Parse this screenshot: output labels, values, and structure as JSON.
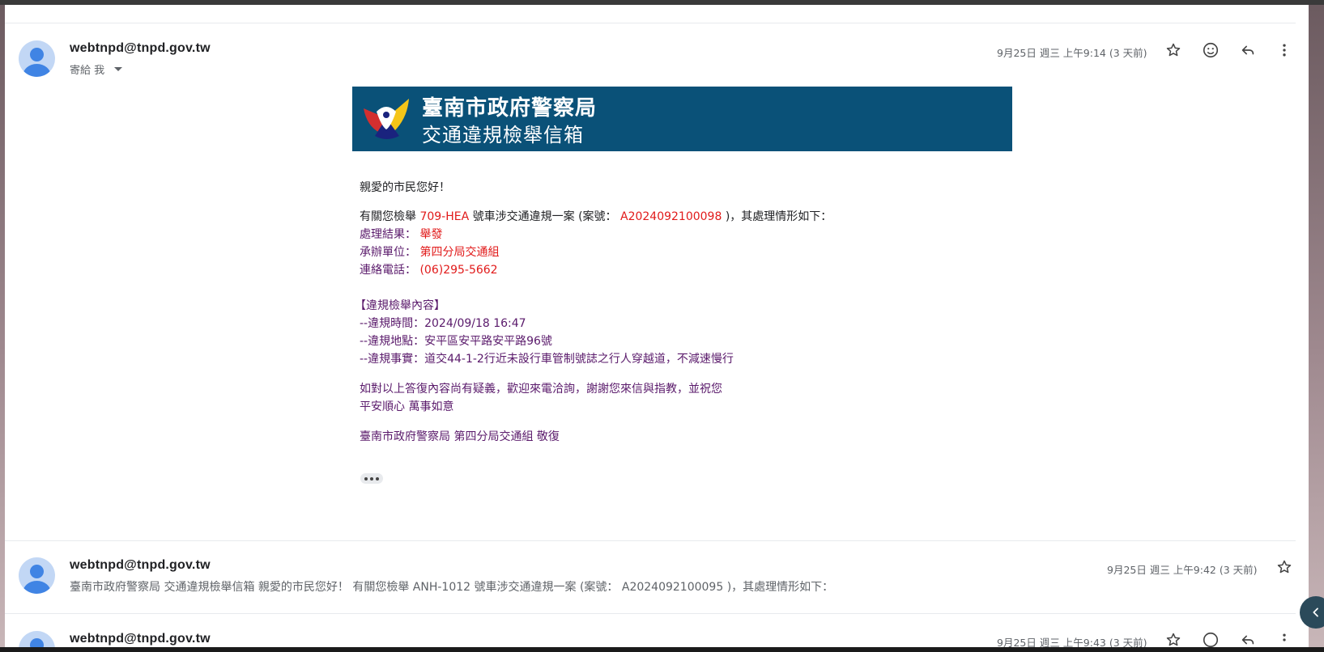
{
  "email1": {
    "sender": "webtnpd@tnpd.gov.tw",
    "to_label": "寄給 我",
    "date": "9月25日 週三 上午9:14 (3 天前)",
    "icons": [
      "star-icon",
      "emoji-icon",
      "reply-icon",
      "more-vert-icon"
    ],
    "banner": {
      "title": "臺南市政府警察局",
      "subtitle": "交通違規檢舉信箱"
    },
    "greeting": "親愛的市民您好！",
    "intro": {
      "part1": "有關您檢舉 ",
      "plate": "709-HEA",
      "part2": " 號車涉交通違規一案 (案號： ",
      "case_no": "A2024092100098",
      "part3": " )，其處理情形如下："
    },
    "result_label": "處理結果：",
    "result_value": "舉發",
    "unit_label": "承辦單位：",
    "unit_value": "第四分局交通組",
    "phone_label": "連絡電話：",
    "phone_value": "(06)295-5662",
    "section_title": "【違規檢舉內容】",
    "time_line": "--違規時間：2024/09/18 16:47",
    "place_line": "--違規地點：安平區安平路安平路96號",
    "fact_line": "--違規事實：道交44-1-2行近未設行車管制號誌之行人穿越道，不減速慢行",
    "closing1": "如對以上答復內容尚有疑義，歡迎來電洽詢，謝謝您來信與指教，並祝您",
    "closing2": "平安順心 萬事如意",
    "signature": "臺南市政府警察局 第四分局交通組 敬復"
  },
  "email2": {
    "sender": "webtnpd@tnpd.gov.tw",
    "date": "9月25日 週三 上午9:42 (3 天前)",
    "snippet": "臺南市政府警察局 交通違規檢舉信箱 親愛的市民您好！ 有關您檢舉 ANH-1012 號車涉交通違規一案 (案號： A2024092100095 )，其處理情形如下："
  },
  "email3": {
    "sender": "webtnpd@tnpd.gov.tw",
    "date": "9月25日 週三 上午9:43 (3 天前)"
  },
  "colors": {
    "banner": "#0a5178",
    "highlight_red": "#e11a1a",
    "body_purple": "#5a1a6b"
  }
}
